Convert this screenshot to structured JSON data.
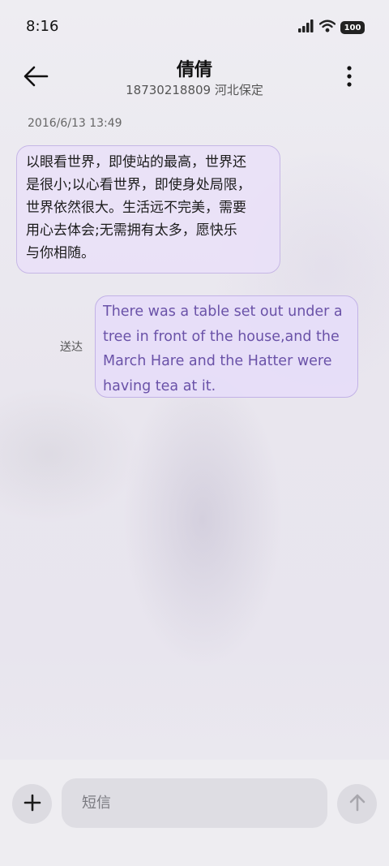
{
  "status_bar": {
    "time": "8:16",
    "battery": "100",
    "icons": [
      "signal-icon",
      "wifi-icon",
      "battery-icon"
    ]
  },
  "header": {
    "title": "倩倩",
    "subtitle": "18730218809 河北保定",
    "back_icon": "back-arrow-icon",
    "more_icon": "more-vertical-icon"
  },
  "conversation": {
    "timestamp": "2016/6/13 13:49",
    "incoming_message": {
      "lines": [
        "以眼看世界，即使站的最高，世界还",
        "是很小;以心看世界，即使身处局限，",
        "世界依然很大。生活远不完美，需要",
        "用心去体会;无需拥有太多，愿快乐",
        "与你相随。"
      ]
    },
    "outgoing_message": {
      "status": "送达",
      "lines": [
        "There was a table set out under a",
        "tree in front of the house,and the",
        "March Hare and the Hatter were",
        "having tea at it."
      ]
    }
  },
  "composer": {
    "placeholder": "短信",
    "value": "",
    "add_icon": "plus-icon",
    "send_icon": "send-arrow-up-icon"
  },
  "colors": {
    "bubble_fill": "#e9e1f7",
    "bubble_border": "#c6b7e6",
    "outgoing_text": "#6a52a8"
  }
}
